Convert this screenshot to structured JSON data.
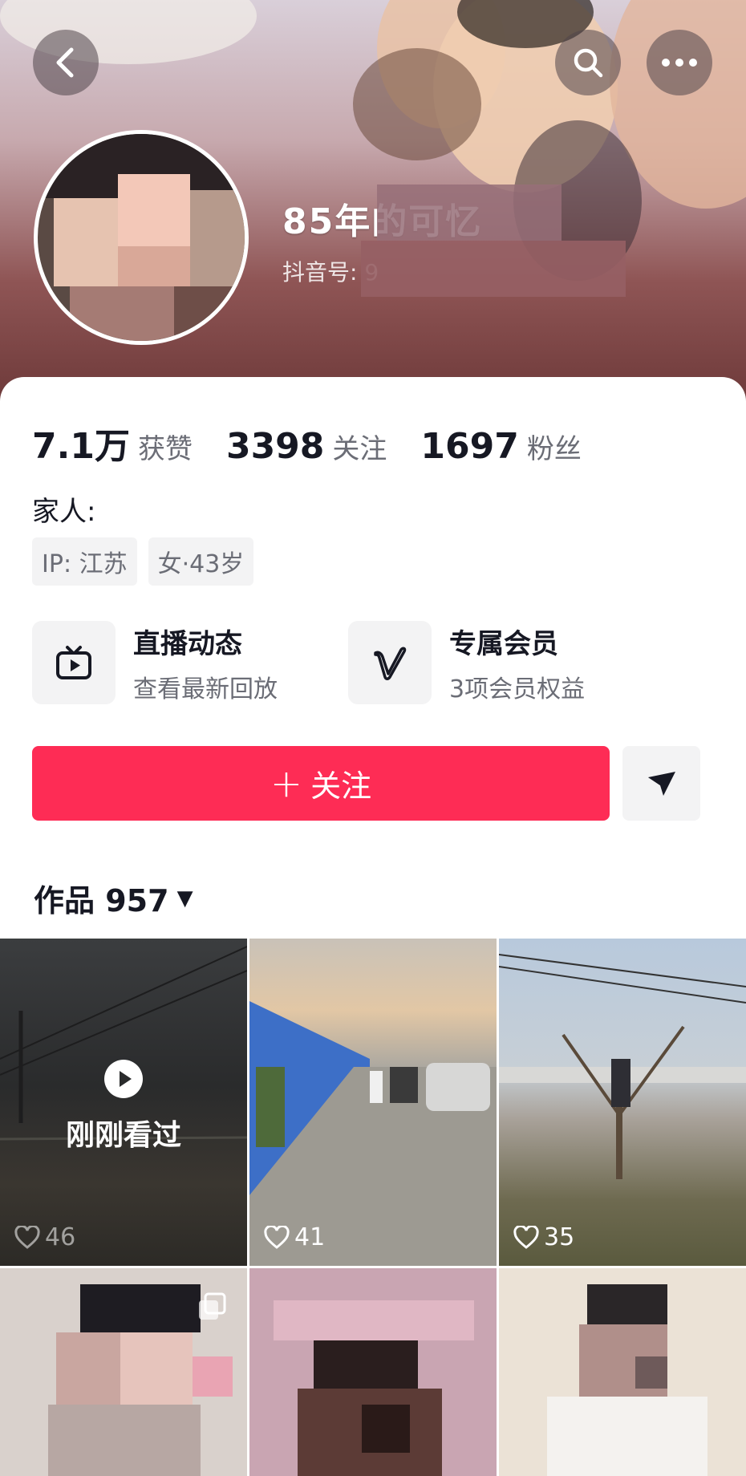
{
  "header": {
    "name": "85年的可忆",
    "douyin_id": "抖音号: 9"
  },
  "stats": [
    {
      "value": "7.1万",
      "label": "获赞"
    },
    {
      "value": "3398",
      "label": "关注"
    },
    {
      "value": "1697",
      "label": "粉丝"
    }
  ],
  "bio": "家人:",
  "tags": [
    "IP: 江苏",
    "女·43岁"
  ],
  "features": {
    "live": {
      "title": "直播动态",
      "subtitle": "查看最新回放"
    },
    "vip": {
      "title": "专属会员",
      "subtitle": "3项会员权益"
    }
  },
  "follow_button": {
    "plus": "+",
    "label": "关注"
  },
  "works": {
    "label": "作品 957"
  },
  "grid": [
    {
      "likes": "46",
      "watched_label": "刚刚看过"
    },
    {
      "likes": "41"
    },
    {
      "likes": "35"
    },
    {},
    {},
    {}
  ],
  "colors": {
    "accent": "#fe2c55",
    "text": "#161823",
    "subtext": "#6b6d76"
  }
}
